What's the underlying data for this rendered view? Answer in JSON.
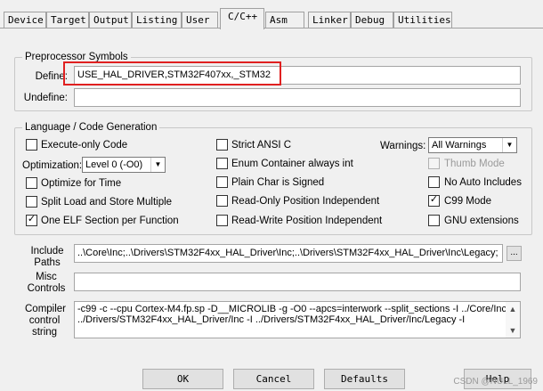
{
  "tabs": [
    {
      "label": "Device"
    },
    {
      "label": "Target"
    },
    {
      "label": "Output"
    },
    {
      "label": "Listing"
    },
    {
      "label": "User"
    },
    {
      "label": "C/C++"
    },
    {
      "label": "Asm"
    },
    {
      "label": "Linker"
    },
    {
      "label": "Debug"
    },
    {
      "label": "Utilities"
    }
  ],
  "preprocessor": {
    "title": "Preprocessor Symbols",
    "define_label": "Define:",
    "define_value": "USE_HAL_DRIVER,STM32F407xx,_STM32",
    "undefine_label": "Undefine:",
    "undefine_value": ""
  },
  "language": {
    "title": "Language / Code Generation",
    "execute_only": "Execute-only Code",
    "optimization_label": "Optimization:",
    "optimization_value": "Level 0 (-O0)",
    "optimize_time": "Optimize for Time",
    "split_load": "Split Load and Store Multiple",
    "one_elf": "One ELF Section per Function",
    "strict_ansi": "Strict ANSI C",
    "enum_container": "Enum Container always int",
    "plain_char": "Plain Char is Signed",
    "ro_position": "Read-Only Position Independent",
    "rw_position": "Read-Write Position Independent",
    "warnings_label": "Warnings:",
    "warnings_value": "All Warnings",
    "thumb_mode": "Thumb Mode",
    "no_auto_includes": "No Auto Includes",
    "c99_mode": "C99 Mode",
    "gnu_extensions": "GNU extensions"
  },
  "paths": {
    "include_label_1": "Include",
    "include_label_2": "Paths",
    "include_value": "..\\Core\\Inc;..\\Drivers\\STM32F4xx_HAL_Driver\\Inc;..\\Drivers\\STM32F4xx_HAL_Driver\\Inc\\Legacy;",
    "browse_label": "...",
    "misc_label_1": "Misc",
    "misc_label_2": "Controls",
    "misc_value": "",
    "compiler_label_1": "Compiler",
    "compiler_label_2": "control",
    "compiler_label_3": "string",
    "compiler_line_1": "-c99 -c --cpu Cortex-M4.fp.sp -D__MICROLIB -g -O0 --apcs=interwork --split_sections -I ../Core/Inc -I",
    "compiler_line_2": "../Drivers/STM32F4xx_HAL_Driver/Inc -I ../Drivers/STM32F4xx_HAL_Driver/Inc/Legacy -I"
  },
  "buttons": {
    "ok": "OK",
    "cancel": "Cancel",
    "defaults": "Defaults",
    "help": "Help"
  },
  "watermark": "CSDN @NULL_1969",
  "icons": {
    "checkmark": "✓",
    "dropdown": "▼",
    "scroll_up": "▲",
    "scroll_down": "▼"
  }
}
